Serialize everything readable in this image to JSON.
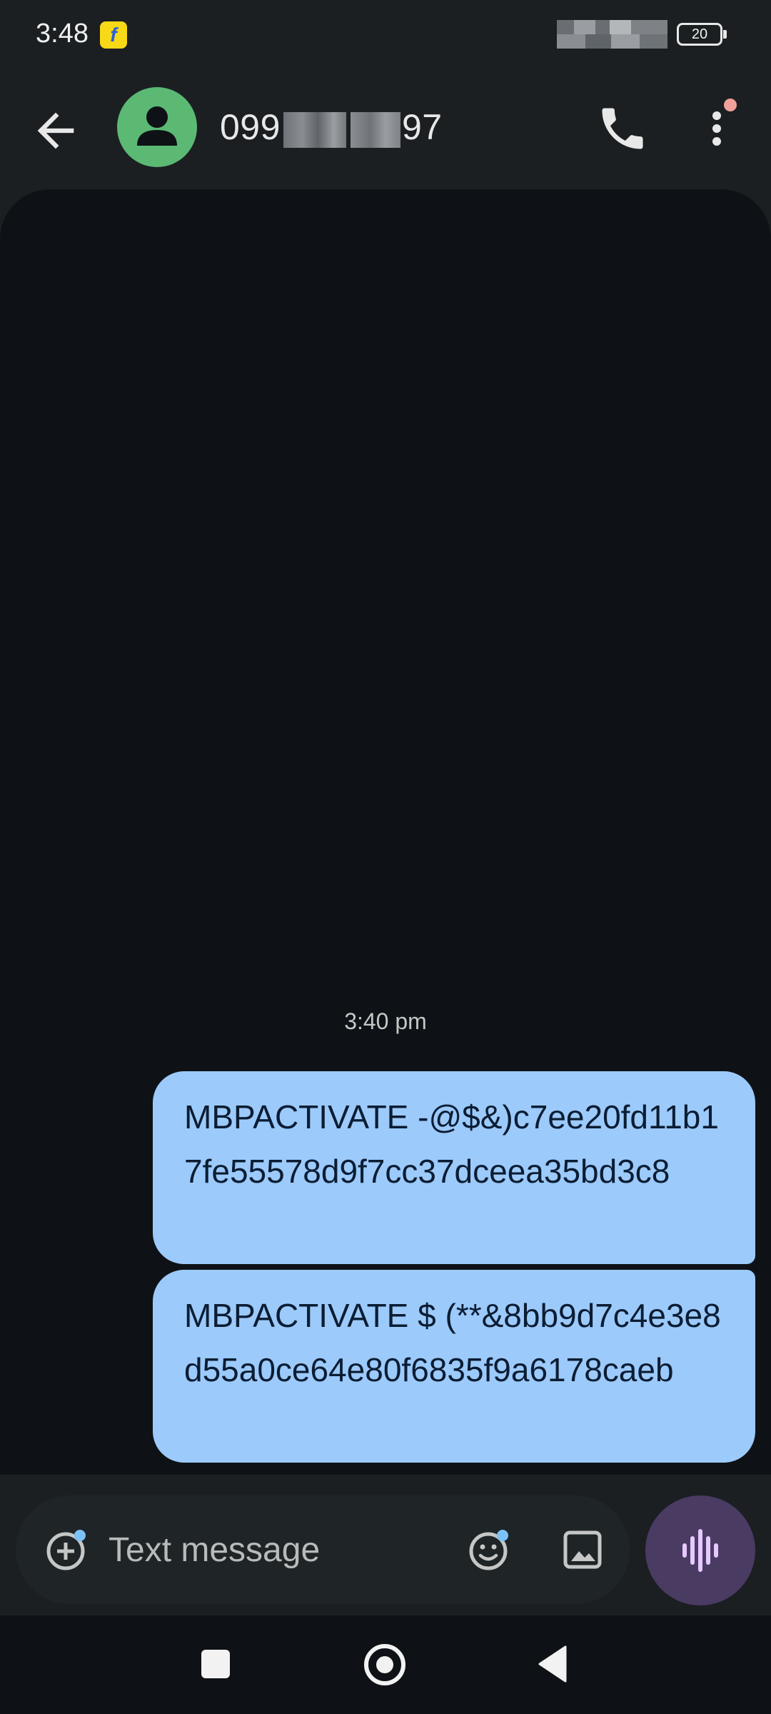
{
  "status_bar": {
    "time": "3:48",
    "notification_icon": "flipkart-icon",
    "battery_level": "20"
  },
  "app_bar": {
    "back_icon": "arrow-back-icon",
    "avatar_icon": "person-icon",
    "contact_prefix": "099",
    "contact_suffix": "97",
    "call_icon": "phone-icon",
    "menu_icon": "more-vert-icon"
  },
  "conversation": {
    "timestamp": "3:40 pm",
    "messages": [
      {
        "text": "MBPACTIVATE -@$&)c7ee20fd11b17fe55578d9f7cc37dceea35bd3c8",
        "direction": "outgoing"
      },
      {
        "text": "MBPACTIVATE $ (**&8bb9d7c4e3e8d55a0ce64e80f6835f9a6178caeb",
        "direction": "outgoing"
      }
    ]
  },
  "compose": {
    "placeholder": "Text message",
    "add_icon": "add-circle-icon",
    "emoji_icon": "emoji-icon",
    "gallery_icon": "image-icon",
    "voice_icon": "voice-waveform-icon"
  },
  "colors": {
    "outgoing_bubble": "#9ccafb",
    "avatar": "#5bb974",
    "voice_button": "#4a3b63"
  }
}
